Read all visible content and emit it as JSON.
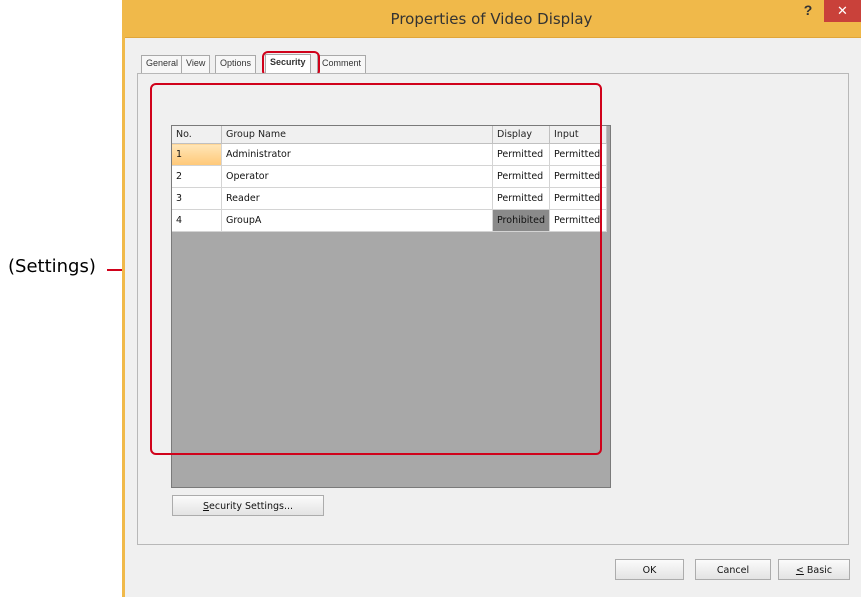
{
  "callout": {
    "label": "(Settings)",
    "color": "#d0021b"
  },
  "window": {
    "title": "Properties of Video Display",
    "help": "?",
    "close": "✕"
  },
  "tabs": [
    {
      "label": "General"
    },
    {
      "label": "View"
    },
    {
      "label": "Options"
    },
    {
      "label": "Security",
      "active": true
    },
    {
      "label": "Comment"
    }
  ],
  "table": {
    "headers": [
      "No.",
      "Group Name",
      "Display",
      "Input"
    ],
    "rows": [
      {
        "no": "1",
        "name": "Administrator",
        "display": "Permitted",
        "input": "Permitted"
      },
      {
        "no": "2",
        "name": "Operator",
        "display": "Permitted",
        "input": "Permitted"
      },
      {
        "no": "3",
        "name": "Reader",
        "display": "Permitted",
        "input": "Permitted"
      },
      {
        "no": "4",
        "name": "GroupA",
        "display": "Prohibited",
        "input": "Permitted"
      }
    ]
  },
  "buttons": {
    "security_settings_pre": "S",
    "security_settings_rest": "ecurity Settings...",
    "ok": "OK",
    "cancel": "Cancel",
    "basic_pre": "<",
    "basic_rest": " Basic"
  }
}
